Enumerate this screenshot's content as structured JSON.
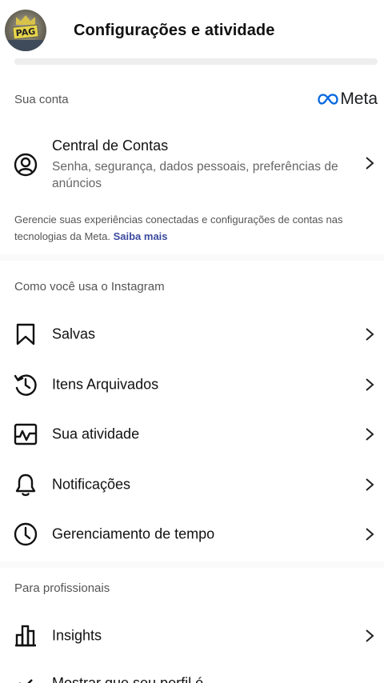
{
  "header": {
    "title": "Configurações e atividade",
    "avatar_text": "PAG"
  },
  "account_section": {
    "label": "Sua conta",
    "meta_logo_text": "Meta",
    "accounts_center": {
      "title": "Central de Contas",
      "subtitle": "Senha, segurança, dados pessoais, preferências de anúncios"
    },
    "info_text": "Gerencie suas experiências conectadas e configurações de contas nas tecnologias da Meta.",
    "info_link": "Saiba mais"
  },
  "usage_section": {
    "label": "Como você usa o Instagram",
    "items": [
      {
        "label": "Salvas",
        "icon": "bookmark-icon"
      },
      {
        "label": "Itens Arquivados",
        "icon": "archive-history-icon"
      },
      {
        "label": "Sua atividade",
        "icon": "activity-icon"
      },
      {
        "label": "Notificações",
        "icon": "bell-icon"
      },
      {
        "label": "Gerenciamento de tempo",
        "icon": "clock-icon"
      }
    ]
  },
  "pro_section": {
    "label": "Para profissionais",
    "items": [
      {
        "label": "Insights",
        "icon": "bar-chart-icon"
      },
      {
        "label": "Mostrar que seu perfil é",
        "icon": "verified-icon"
      }
    ]
  },
  "colors": {
    "link": "#3b4a9e",
    "meta_blue": "#0668E1"
  }
}
